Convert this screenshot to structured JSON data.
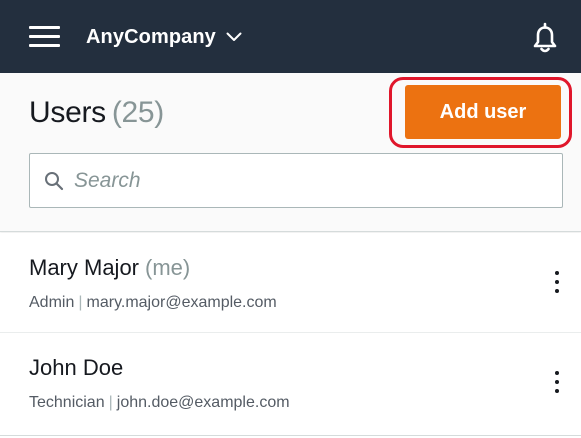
{
  "topbar": {
    "menu_icon": "hamburger-menu-icon",
    "company_name": "AnyCompany",
    "company_chevron_icon": "chevron-down-icon",
    "notifications_icon": "bell-icon",
    "background": "#232f3e"
  },
  "header": {
    "title": "Users",
    "count": "(25)",
    "add_user_label": "Add user",
    "accent": "#ec7211",
    "highlight_color": "#e0162b"
  },
  "search": {
    "placeholder": "Search",
    "value": "",
    "icon": "search-icon"
  },
  "users": [
    {
      "name": "Mary Major",
      "me_label": "(me)",
      "role": "Admin",
      "separator": "|",
      "email": "mary.major@example.com",
      "menu_icon": "more-vertical-icon"
    },
    {
      "name": "John Doe",
      "me_label": "",
      "role": "Technician",
      "separator": "|",
      "email": "john.doe@example.com",
      "menu_icon": "more-vertical-icon"
    }
  ]
}
